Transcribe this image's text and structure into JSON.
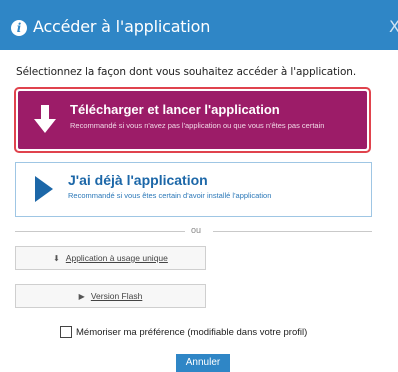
{
  "dialog": {
    "title": "Accéder à l'application",
    "info_icon": "info-icon",
    "close_icon": "close-icon",
    "close_glyph": "X"
  },
  "instruction": "Sélectionnez la façon dont vous souhaitez accéder à l'application.",
  "options": {
    "download": {
      "title": "Télécharger et lancer l'application",
      "subtitle": "Recommandé si vous n'avez pas l'application ou que vous n'êtes pas certain",
      "icon": "download-arrow-icon",
      "selected": true
    },
    "existing": {
      "title": "J'ai déjà l'application",
      "subtitle": "Recommandé si vous êtes certain d'avoir installé l'application",
      "icon": "play-icon"
    }
  },
  "divider_text": "ou",
  "alt_buttons": {
    "single_use": {
      "label": "Application à usage unique",
      "icon": "download-arrow-icon"
    },
    "flash": {
      "label": "Version Flash",
      "icon": "play-icon"
    }
  },
  "remember": {
    "label": "Mémoriser ma préférence (modifiable dans votre profil)",
    "checked": false
  },
  "cancel_label": "Annuler",
  "colors": {
    "header_blue": "#2f86c6",
    "download_purple": "#9c1c68",
    "selection_red": "#e0434d",
    "existing_blue": "#1c67a8"
  }
}
